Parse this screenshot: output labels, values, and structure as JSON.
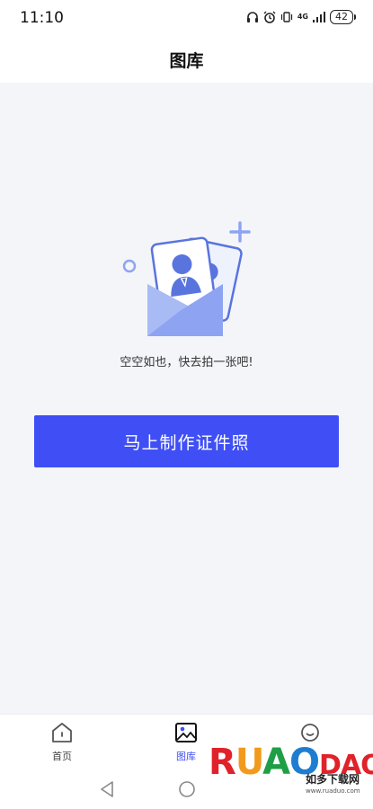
{
  "status_bar": {
    "time": "11:10",
    "network": "4G",
    "battery": "42"
  },
  "header": {
    "title": "图库"
  },
  "empty_state": {
    "message": "空空如也，快去拍一张吧!",
    "illustration_icon": "photo-cards-envelope-icon"
  },
  "actions": {
    "create_button_label": "马上制作证件照"
  },
  "tab_bar": {
    "tabs": [
      {
        "label": "首页",
        "icon": "home-icon",
        "active": false
      },
      {
        "label": "图库",
        "icon": "gallery-icon",
        "active": true
      },
      {
        "label": "",
        "icon": "smile-icon",
        "active": false
      }
    ]
  },
  "watermark": {
    "brand": "RUANDAO",
    "chinese": "如多下载网",
    "url": "www.ruaduo.com"
  },
  "colors": {
    "accent": "#3f4ff5",
    "background": "#f3f5f9",
    "illustration_blue": "#8ea4f2"
  }
}
